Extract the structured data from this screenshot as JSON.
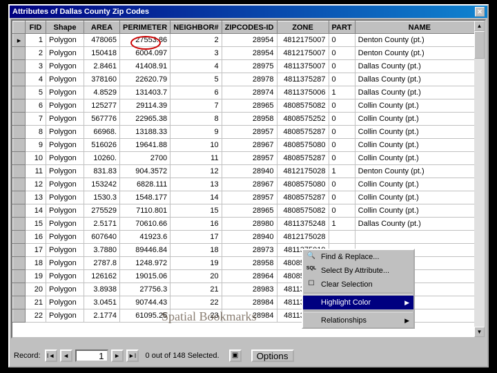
{
  "title": "Attributes of Dallas County Zip Codes",
  "columns": [
    "FID",
    "Shape",
    "AREA",
    "PERIMETER",
    "NEIGHBOR#",
    "ZIPCODES-ID",
    "ZONE",
    "PART",
    "NAME"
  ],
  "rows": [
    {
      "fid": "1",
      "shape": "Polygon",
      "area": "478065",
      "perim": "27553.86",
      "neigh": "2",
      "zip": "28954",
      "zone": "4812175007",
      "part": "0",
      "name": "Denton County (pt.)"
    },
    {
      "fid": "2",
      "shape": "Polygon",
      "area": "150418",
      "perim": "6004.097",
      "neigh": "3",
      "zip": "28954",
      "zone": "4812175007",
      "part": "0",
      "name": "Denton County (pt.)"
    },
    {
      "fid": "3",
      "shape": "Polygon",
      "area": "2.8461",
      "perim": "41408.91",
      "neigh": "4",
      "zip": "28975",
      "zone": "4811375007",
      "part": "0",
      "name": "Dallas County (pt.)"
    },
    {
      "fid": "4",
      "shape": "Polygon",
      "area": "378160",
      "perim": "22620.79",
      "neigh": "5",
      "zip": "28978",
      "zone": "4811375287",
      "part": "0",
      "name": "Dallas County (pt.)"
    },
    {
      "fid": "5",
      "shape": "Polygon",
      "area": "4.8529",
      "perim": "131403.7",
      "neigh": "6",
      "zip": "28974",
      "zone": "4811375006",
      "part": "1",
      "name": "Dallas County (pt.)"
    },
    {
      "fid": "6",
      "shape": "Polygon",
      "area": "125277",
      "perim": "29114.39",
      "neigh": "7",
      "zip": "28965",
      "zone": "4808575082",
      "part": "0",
      "name": "Collin County (pt.)"
    },
    {
      "fid": "7",
      "shape": "Polygon",
      "area": "567776",
      "perim": "22965.38",
      "neigh": "8",
      "zip": "28958",
      "zone": "4808575252",
      "part": "0",
      "name": "Collin County (pt.)"
    },
    {
      "fid": "8",
      "shape": "Polygon",
      "area": "66968.",
      "perim": "13188.33",
      "neigh": "9",
      "zip": "28957",
      "zone": "4808575287",
      "part": "0",
      "name": "Collin County (pt.)"
    },
    {
      "fid": "9",
      "shape": "Polygon",
      "area": "516026",
      "perim": "19641.88",
      "neigh": "10",
      "zip": "28967",
      "zone": "4808575080",
      "part": "0",
      "name": "Collin County (pt.)"
    },
    {
      "fid": "10",
      "shape": "Polygon",
      "area": "10260.",
      "perim": "2700",
      "neigh": "11",
      "zip": "28957",
      "zone": "4808575287",
      "part": "0",
      "name": "Collin County (pt.)"
    },
    {
      "fid": "11",
      "shape": "Polygon",
      "area": "831.83",
      "perim": "904.3572",
      "neigh": "12",
      "zip": "28940",
      "zone": "4812175028",
      "part": "1",
      "name": "Denton County (pt.)"
    },
    {
      "fid": "12",
      "shape": "Polygon",
      "area": "153242",
      "perim": "6828.111",
      "neigh": "13",
      "zip": "28967",
      "zone": "4808575080",
      "part": "0",
      "name": "Collin County (pt.)"
    },
    {
      "fid": "13",
      "shape": "Polygon",
      "area": "1530.3",
      "perim": "1548.177",
      "neigh": "14",
      "zip": "28957",
      "zone": "4808575287",
      "part": "0",
      "name": "Collin County (pt.)"
    },
    {
      "fid": "14",
      "shape": "Polygon",
      "area": "275529",
      "perim": "7110.801",
      "neigh": "15",
      "zip": "28965",
      "zone": "4808575082",
      "part": "0",
      "name": "Collin County (pt.)"
    },
    {
      "fid": "15",
      "shape": "Polygon",
      "area": "2.5171",
      "perim": "70610.66",
      "neigh": "16",
      "zip": "28980",
      "zone": "4811375248",
      "part": "1",
      "name": "Dallas County (pt.)"
    },
    {
      "fid": "16",
      "shape": "Polygon",
      "area": "607640",
      "perim": "41923.6",
      "neigh": "17",
      "zip": "28940",
      "zone": "4812175028",
      "part": "",
      "name": ""
    },
    {
      "fid": "17",
      "shape": "Polygon",
      "area": "3.7880",
      "perim": "89446.84",
      "neigh": "18",
      "zip": "28973",
      "zone": "4811375019",
      "part": "",
      "name": ""
    },
    {
      "fid": "18",
      "shape": "Polygon",
      "area": "2787.8",
      "perim": "1248.972",
      "neigh": "19",
      "zip": "28958",
      "zone": "4808575252",
      "part": "",
      "name": ""
    },
    {
      "fid": "19",
      "shape": "Polygon",
      "area": "126162",
      "perim": "19015.06",
      "neigh": "20",
      "zip": "28964",
      "zone": "4808575048",
      "part": "",
      "name": ""
    },
    {
      "fid": "20",
      "shape": "Polygon",
      "area": "3.8938",
      "perim": "27756.3",
      "neigh": "21",
      "zip": "28983",
      "zone": "4811375082",
      "part": "",
      "name": ""
    },
    {
      "fid": "21",
      "shape": "Polygon",
      "area": "3.0451",
      "perim": "90744.43",
      "neigh": "22",
      "zip": "28984",
      "zone": "4811375044",
      "part": "",
      "name": ""
    },
    {
      "fid": "22",
      "shape": "Polygon",
      "area": "2.1774",
      "perim": "61095.25",
      "neigh": "23",
      "zip": "28984",
      "zone": "4811375044",
      "part": "",
      "name": ""
    }
  ],
  "context_menu": {
    "find": "Find & Replace...",
    "select_attr": "Select By Attribute...",
    "clear": "Clear Selection",
    "highlight": "Highlight Color",
    "relationships": "Relationships"
  },
  "status": {
    "record_label": "Record:",
    "record_value": "1",
    "selection_text": "0 out of 148 Selected.",
    "options": "Options"
  },
  "watermark": "Spatial Bookmarks"
}
